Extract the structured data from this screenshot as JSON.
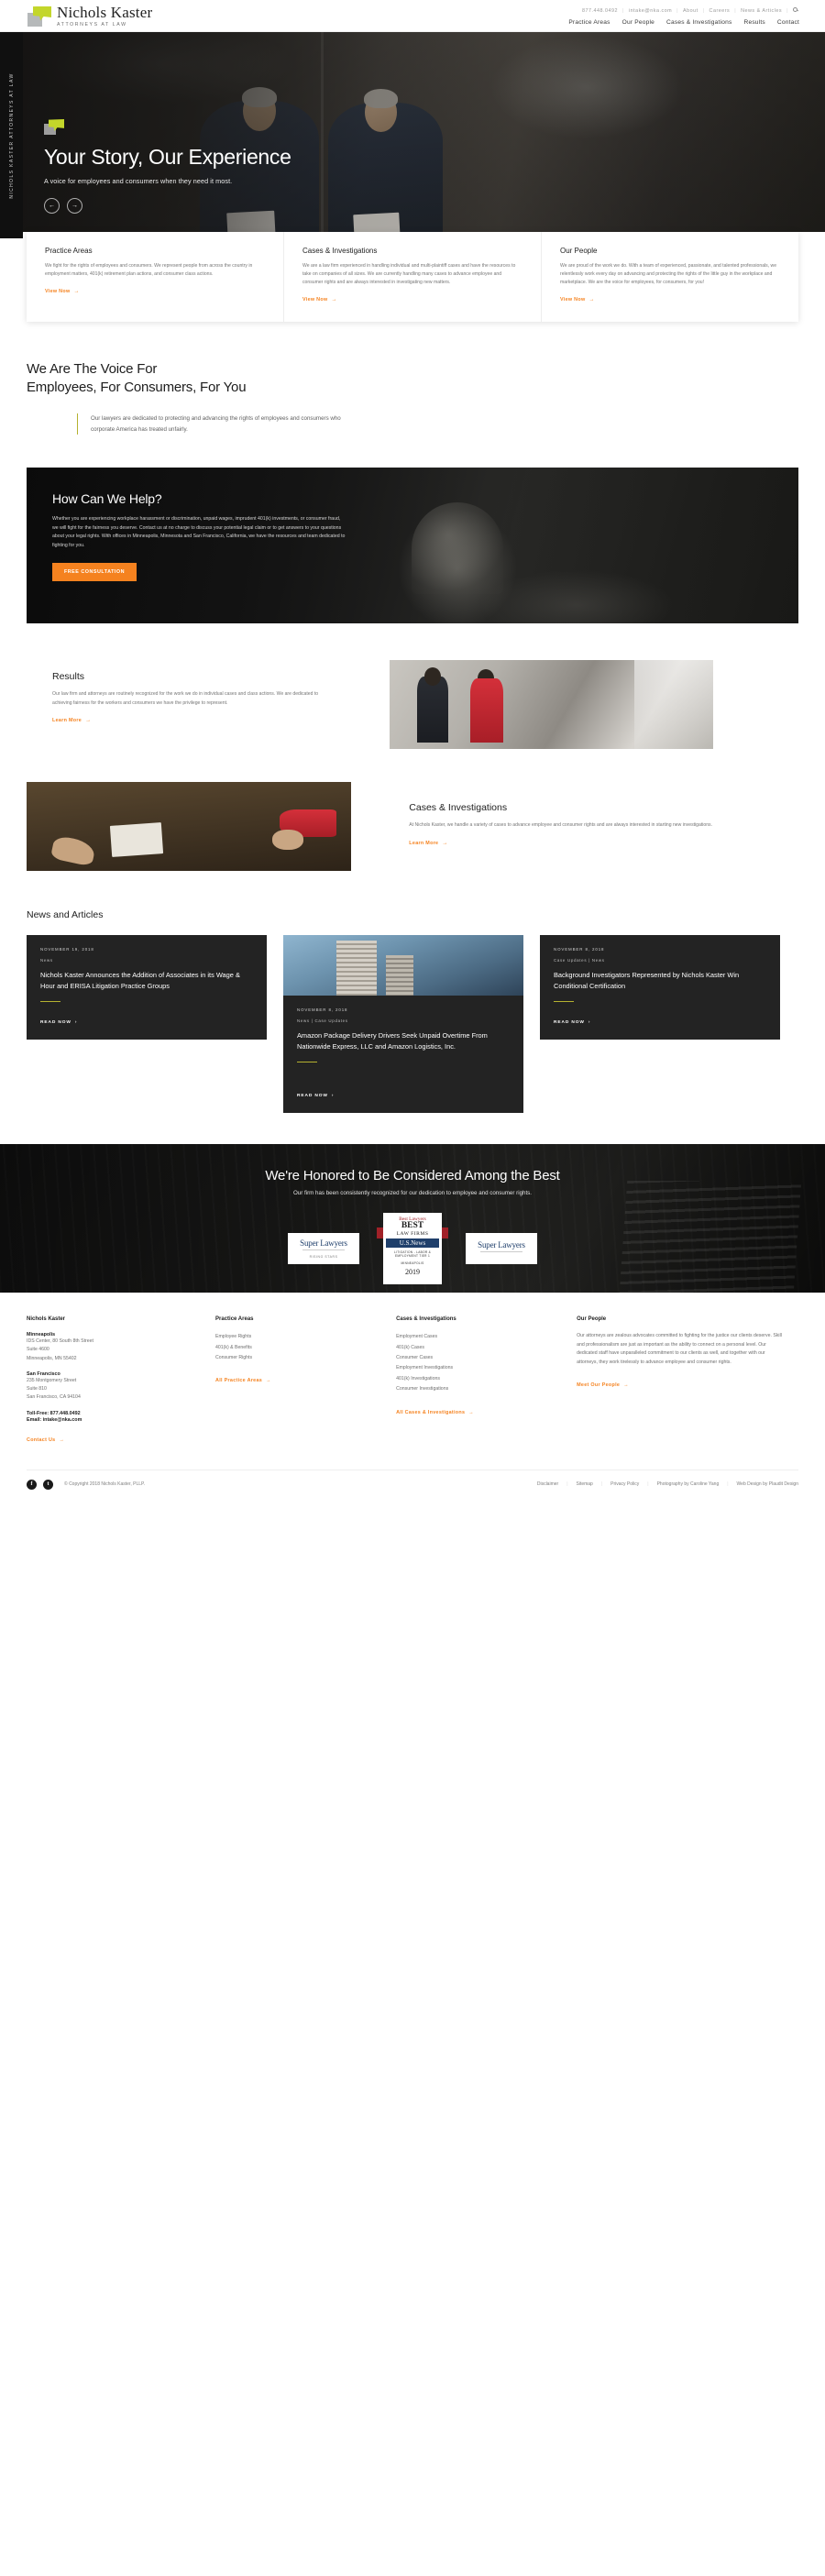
{
  "header": {
    "logo_name": "Nichols Kaster",
    "logo_tagline": "ATTORNEYS AT LAW",
    "utility": [
      {
        "label": "877.448.0492"
      },
      {
        "label": "intake@nka.com"
      },
      {
        "label": "About"
      },
      {
        "label": "Careers"
      },
      {
        "label": "News & Articles"
      }
    ],
    "search_icon": "search-icon",
    "nav": [
      {
        "label": "Practice Areas"
      },
      {
        "label": "Our People"
      },
      {
        "label": "Cases & Investigations"
      },
      {
        "label": "Results"
      },
      {
        "label": "Contact"
      }
    ]
  },
  "hero": {
    "side_rail": "NICHOLS KASTER ATTORNEYS AT LAW",
    "title": "Your Story, Our Experience",
    "subtitle": "A voice for employees and consumers when they need it most.",
    "prev_label": "←",
    "next_label": "→"
  },
  "cards": [
    {
      "title": "Practice Areas",
      "body": "We fight for the rights of employees and consumers. We represent people from across the country in employment matters, 401(k) retirement plan actions, and consumer class actions.",
      "link": "View Now"
    },
    {
      "title": "Cases & Investigations",
      "body": "We are a law firm experienced in handling individual and multi-plaintiff cases and have the resources to take on companies of all sizes. We are currently handling many cases to advance employee and consumer rights and are always interested in investigating new matters.",
      "link": "View Now"
    },
    {
      "title": "Our People",
      "body": "We are proud of the work we do. With a team of experienced, passionate, and talented professionals, we relentlessly work every day on advancing and protecting the rights of the little guy in the workplace and marketplace. We are the voice for employees, for consumers, for you!",
      "link": "View Now"
    }
  ],
  "voice": {
    "heading_line1": "We Are The Voice For",
    "heading_line2": "Employees, For Consumers, For You",
    "quote": "Our lawyers are dedicated to protecting and advancing the rights of employees and consumers who corporate America has treated unfairly."
  },
  "help": {
    "title": "How Can We Help?",
    "body": "Whether you are experiencing workplace harassment or discrimination, unpaid wages, imprudent 401(k) investments, or consumer fraud, we will fight for the fairness you deserve. Contact us at no charge to discuss your potential legal claim or to get answers to your questions about your legal rights. With offices in Minneapolis, Minnesota and San Francisco, California, we have the resources and team dedicated to fighting for you.",
    "cta": "FREE CONSULTATION"
  },
  "features": [
    {
      "title": "Results",
      "body": "Our law firm and attorneys are routinely recognized for the work we do in individual cases and class actions. We are dedicated to achieving fairness for the workers and consumers we have the privilege to represent.",
      "link": "Learn More"
    },
    {
      "title": "Cases & Investigations",
      "body": "At Nichols Kaster, we handle a variety of cases to advance employee and consumer rights and are always interested in starting new investigations.",
      "link": "Learn More"
    }
  ],
  "news": {
    "heading": "News and Articles",
    "read_label": "READ NOW",
    "items": [
      {
        "date": "NOVEMBER 19, 2018",
        "tags": "News",
        "title": "Nichols Kaster Announces the Addition of Associates in its Wage & Hour and ERISA Litigation Practice Groups",
        "has_image": false
      },
      {
        "date": "NOVEMBER 8, 2018",
        "tags": "News  |  Case Updates",
        "title": "Amazon Package Delivery Drivers Seek Unpaid Overtime From Nationwide Express, LLC and Amazon Logistics, Inc.",
        "has_image": true
      },
      {
        "date": "NOVEMBER 8, 2018",
        "tags": "Case Updates  |  News",
        "title": "Background Investigators Represented by Nichols Kaster Win Conditional Certification",
        "has_image": false
      }
    ]
  },
  "honors": {
    "title": "We're Honored to Be Considered Among the Best",
    "subtitle": "Our firm has been consistently recognized for our dedication to employee and consumer rights.",
    "badges": [
      {
        "name": "Super Lawyers",
        "sub": "RISING STARS"
      },
      {
        "name": "Best Lawyers BEST LAW FIRMS U.S.News",
        "line1": "Best Lawyers",
        "line2": "BEST",
        "line3": "LAW FIRMS",
        "line4": "U.S.News",
        "line5": "LITIGATION - LABOR & EMPLOYMENT TIER 1",
        "line6": "MINNEAPOLIS",
        "year": "2019"
      },
      {
        "name": "Super Lawyers",
        "sub": ""
      }
    ]
  },
  "footer": {
    "columns": [
      {
        "heading": "Nichols Kaster",
        "offices": [
          {
            "city": "Minneapolis",
            "lines": [
              "IDS Center, 80 South 8th Street",
              "Suite 4600",
              "Minneapolis, MN 55402"
            ]
          },
          {
            "city": "San Francisco",
            "lines": [
              "235 Montgomery Street",
              "Suite 810",
              "San Francisco, CA 94104"
            ]
          }
        ],
        "contact_lines": [
          "Toll-Free: 877.448.0492",
          "Email: intake@nka.com"
        ],
        "link": "Contact Us"
      },
      {
        "heading": "Practice Areas",
        "items": [
          "Employee Rights",
          "401(k) & Benefits",
          "Consumer Rights"
        ],
        "link": "All Practice Areas"
      },
      {
        "heading": "Cases & Investigations",
        "items": [
          "Employment Cases",
          "401(k) Cases",
          "Consumer Cases",
          "Employment Investigations",
          "401(k) Investigations",
          "Consumer Investigations"
        ],
        "link": "All Cases & Investigations"
      },
      {
        "heading": "Our People",
        "body": "Our attorneys are zealous advocates committed to fighting for the justice our clients deserve. Skill and professionalism are just as important as the ability to connect on a personal level. Our dedicated staff have unparalleled commitment to our clients as well, and together with our attorneys, they work tirelessly to advance employee and consumer rights.",
        "link": "Meet Our People"
      }
    ],
    "copyright": "© Copyright 2018 Nichols Kaster, PLLP.",
    "social": [
      {
        "name": "facebook-icon",
        "glyph": "f"
      },
      {
        "name": "twitter-icon",
        "glyph": "t"
      }
    ],
    "legal": [
      {
        "label": "Disclaimer"
      },
      {
        "label": "Sitemap"
      },
      {
        "label": "Privacy Policy"
      },
      {
        "label": "Photography by Caroline Yang"
      },
      {
        "label": "Web Design by Plaudit Design"
      }
    ]
  },
  "colors": {
    "accent_orange": "#f5821f",
    "accent_green": "#c3d62b",
    "rule_olive": "#b5b130",
    "dark": "#232323"
  }
}
